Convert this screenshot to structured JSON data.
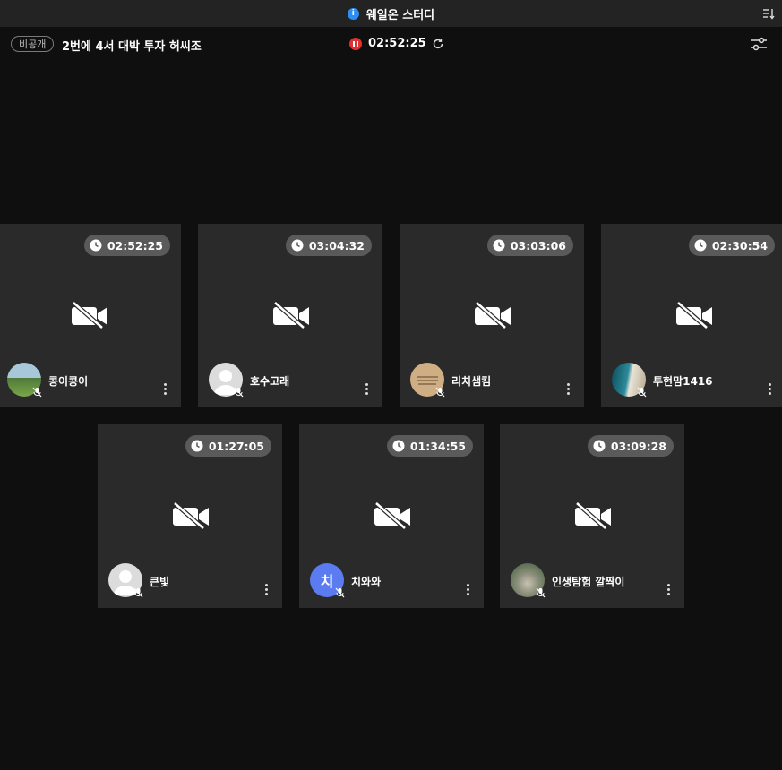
{
  "header": {
    "title": "웨일온 스터디",
    "info_icon": "info-icon",
    "sort_icon": "sort-icon"
  },
  "session": {
    "badge": "비공개",
    "name": "2번에 4서 대박 투자 허씨조",
    "timer": "02:52:25",
    "status_color": "#e03131"
  },
  "participants": [
    {
      "name": "콩이콩이",
      "time": "02:52:25",
      "avatar": "landscape-photo"
    },
    {
      "name": "호수고래",
      "time": "03:04:32",
      "avatar": "default-person"
    },
    {
      "name": "리치샘킴",
      "time": "03:03:06",
      "avatar": "text-image"
    },
    {
      "name": "투현맘1416",
      "time": "02:30:54",
      "avatar": "ocean-photo"
    },
    {
      "name": "큰빛",
      "time": "01:27:05",
      "avatar": "default-person"
    },
    {
      "name": "치와와",
      "time": "01:34:55",
      "avatar": "initial",
      "initial": "치",
      "avatar_color": "#5b7cf0"
    },
    {
      "name": "인생탐험 깔짝이",
      "time": "03:09:28",
      "avatar": "nature-photo"
    }
  ]
}
